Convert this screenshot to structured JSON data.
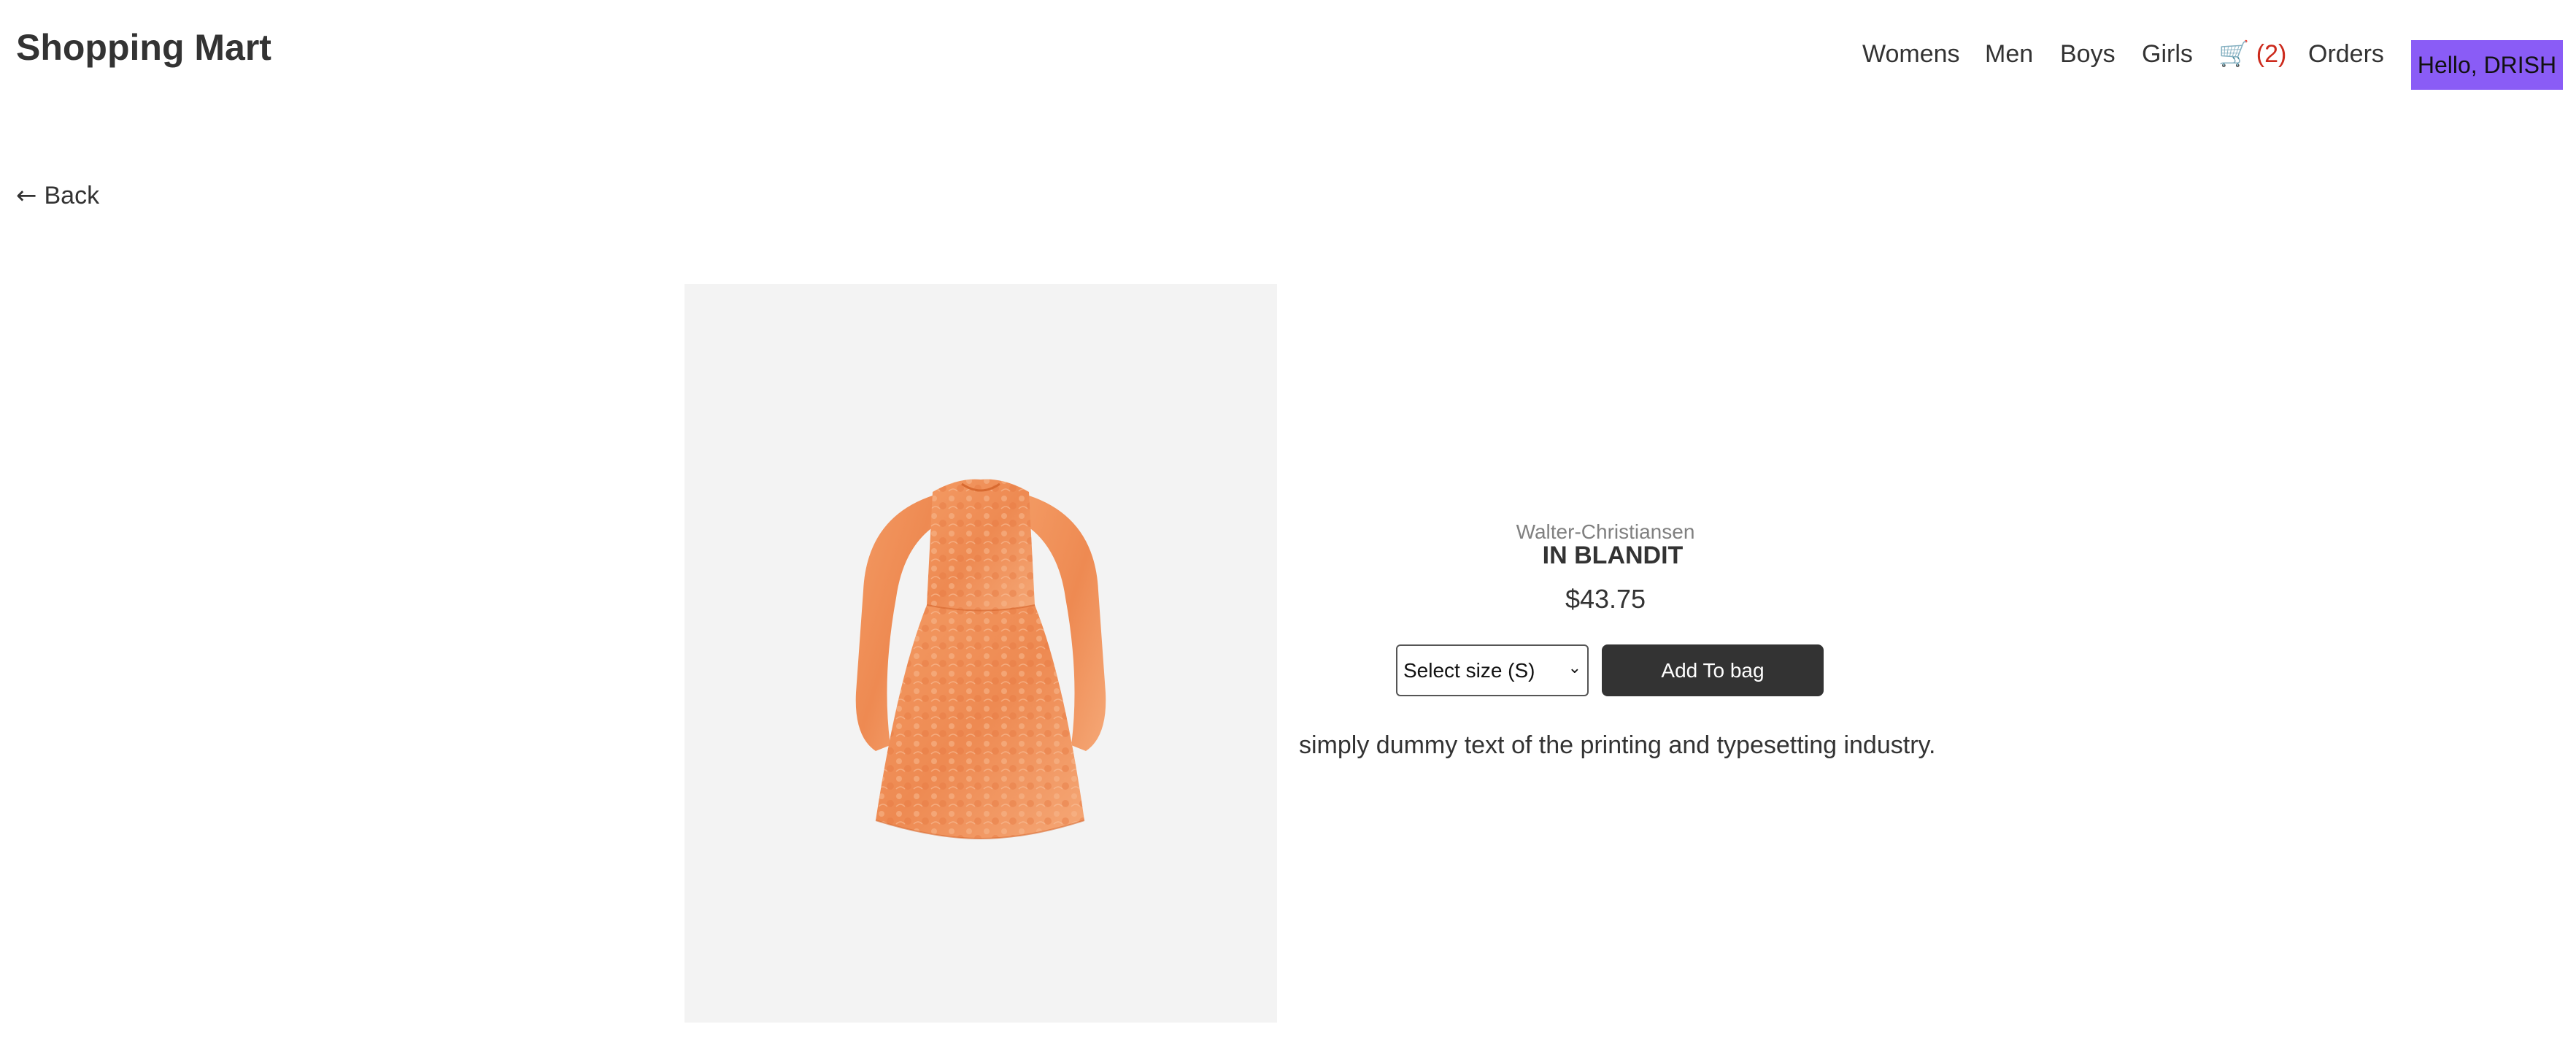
{
  "header": {
    "brand": "Shopping Mart",
    "nav": {
      "womens": "Womens",
      "men": "Men",
      "boys": "Boys",
      "girls": "Girls",
      "cart_icon": "cart-icon",
      "cart_count": "(2)",
      "orders": "Orders"
    },
    "greeting": "Hello, DRISH"
  },
  "back": {
    "arrow": "←",
    "label": "Back"
  },
  "product": {
    "vendor": "Walter-Christiansen",
    "name": "IN BLANDIT",
    "price": "$43.75",
    "size_select_value": "Select size (S)",
    "add_to_bag_label": "Add To bag",
    "description": "simply dummy text of the printing and typesetting industry.",
    "image_icon": "orange-dress-image"
  },
  "colors": {
    "accent": "#8a5cf6",
    "cart_count": "#cc2a1c",
    "button_dark": "#333333"
  }
}
